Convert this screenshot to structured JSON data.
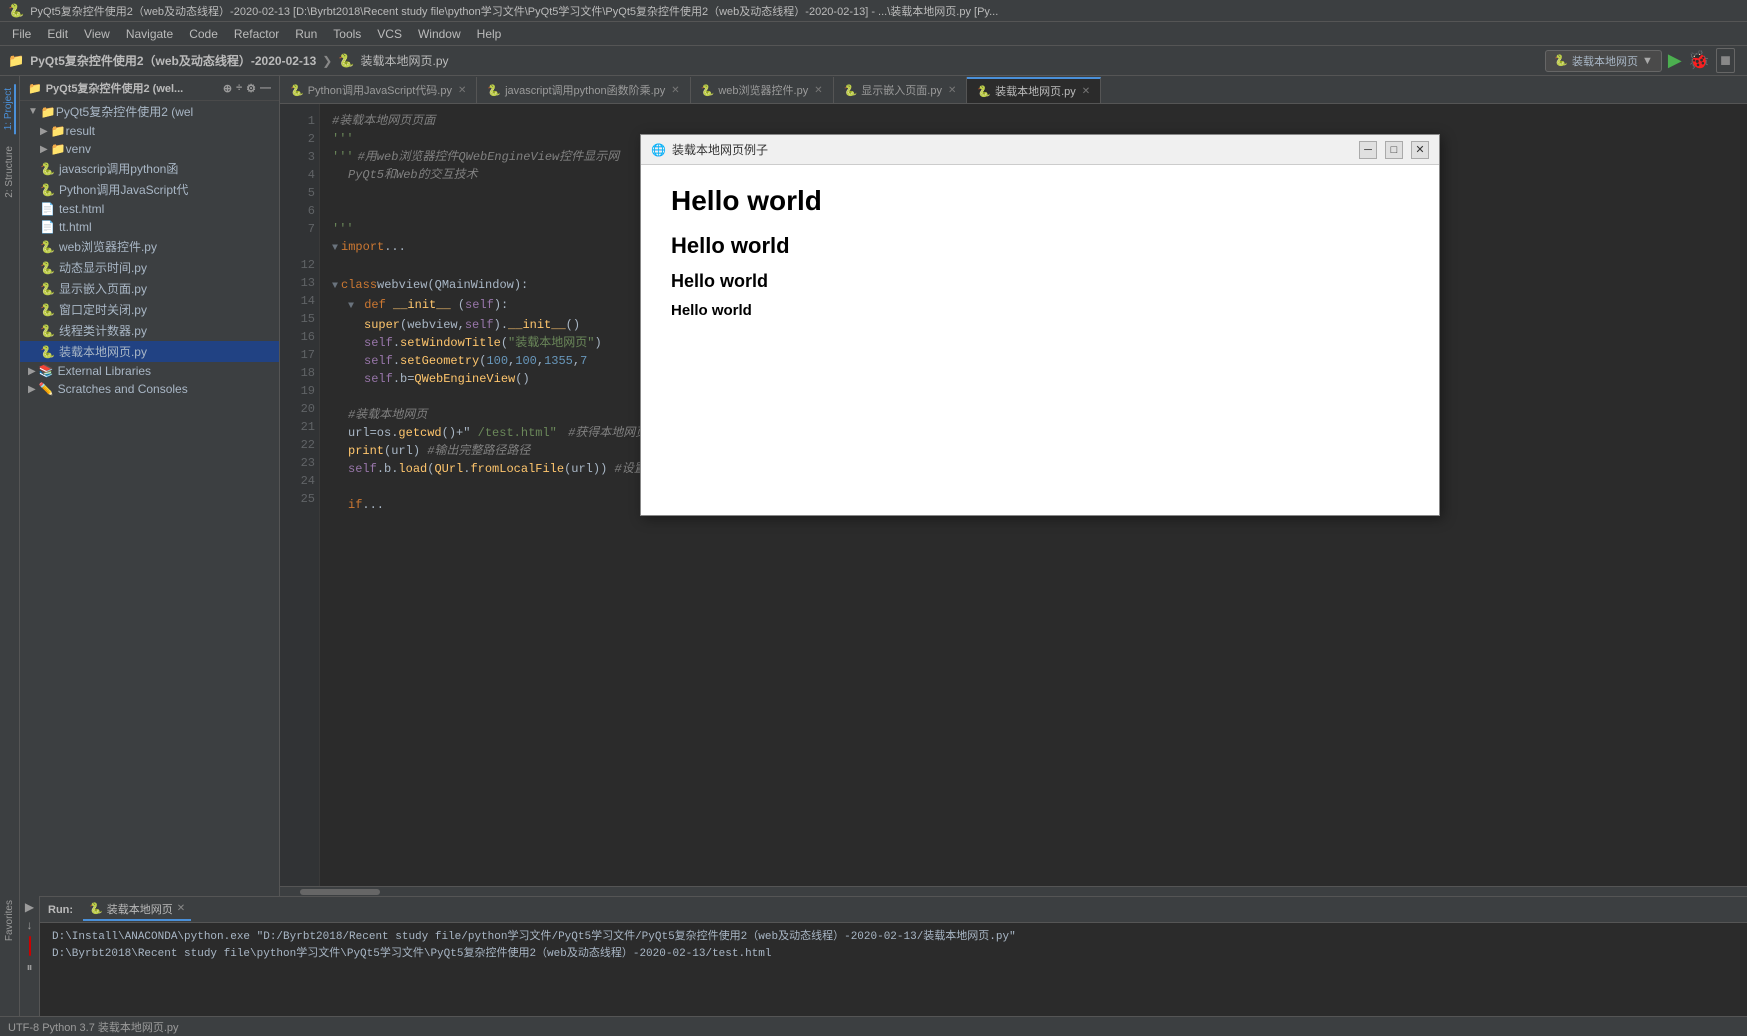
{
  "titlebar": {
    "text": "PyQt5复杂控件使用2（web及动态线程）-2020-02-13 [D:\\Byrbt2018\\Recent study file\\python学习文件\\PyQt5学习文件\\PyQt5复杂控件使用2（web及动态线程）-2020-02-13] - ...\\装载本地网页.py [Py..."
  },
  "menubar": {
    "items": [
      "File",
      "Edit",
      "View",
      "Navigate",
      "Code",
      "Refactor",
      "Run",
      "Tools",
      "VCS",
      "Window",
      "Help"
    ]
  },
  "project_toolbar": {
    "label": "PyQt5复杂控件使用2 (web...",
    "buttons": [
      "⊕",
      "÷",
      "⚙",
      "—"
    ]
  },
  "tabs": [
    {
      "label": "Python调用JavaScript代码.py",
      "active": false,
      "has_close": true
    },
    {
      "label": "javascript调用python函数阶乘.py",
      "active": false,
      "has_close": true
    },
    {
      "label": "web浏览器控件.py",
      "active": false,
      "has_close": true
    },
    {
      "label": "显示嵌入页面.py",
      "active": false,
      "has_close": true
    },
    {
      "label": "装载本地网页.py",
      "active": true,
      "has_close": true
    }
  ],
  "run_toolbar": {
    "run_label": "装载本地网页",
    "run_icon": "▶",
    "debug_icon": "🐞",
    "stop_icon": "■"
  },
  "sidebar": {
    "project_label": "Project",
    "root": "PyQt5复杂控件使用2 (wel...",
    "items": [
      {
        "label": "result",
        "type": "folder",
        "level": 1,
        "expanded": false
      },
      {
        "label": "venv",
        "type": "folder",
        "level": 1,
        "expanded": false
      },
      {
        "label": "javascrip调用python函",
        "type": "py",
        "level": 1
      },
      {
        "label": "Python调用JavaScript代",
        "type": "py",
        "level": 1
      },
      {
        "label": "test.html",
        "type": "html",
        "level": 1
      },
      {
        "label": "tt.html",
        "type": "html",
        "level": 1
      },
      {
        "label": "web浏览器控件.py",
        "type": "py",
        "level": 1
      },
      {
        "label": "动态显示时间.py",
        "type": "py",
        "level": 1
      },
      {
        "label": "显示嵌入页面.py",
        "type": "py",
        "level": 1
      },
      {
        "label": "窗口定时关闭.py",
        "type": "py",
        "level": 1
      },
      {
        "label": "线程类计数器.py",
        "type": "py",
        "level": 1
      },
      {
        "label": "装载本地网页.py",
        "type": "py",
        "level": 1,
        "selected": true
      }
    ],
    "external_libraries": "External Libraries",
    "scratches": "Scratches and Consoles"
  },
  "code": {
    "lines": [
      {
        "num": 1,
        "text": "#装载本地网页页面",
        "type": "comment"
      },
      {
        "num": 2,
        "text": "'''",
        "type": "string"
      },
      {
        "num": 3,
        "text": "'''",
        "type": "string"
      },
      {
        "num": 3,
        "text": "   #用web浏览器控件QWebEngineView控件显示网页  PyQt5和Web的交互技术",
        "type": "comment"
      },
      {
        "num": 4,
        "text": "",
        "type": "normal"
      },
      {
        "num": 5,
        "text": "",
        "type": "normal"
      },
      {
        "num": 6,
        "text": "'''",
        "type": "string"
      },
      {
        "num": 7,
        "text": "import ...",
        "type": "keyword"
      },
      {
        "num": 8,
        "text": "",
        "type": "normal"
      },
      {
        "num": 12,
        "text": "",
        "type": "normal"
      },
      {
        "num": 13,
        "text": "class webview(QMainWindow):",
        "type": "class"
      },
      {
        "num": 14,
        "text": "    def __init__(self):",
        "type": "func"
      },
      {
        "num": 15,
        "text": "        super(webview,self).__init__()",
        "type": "normal"
      },
      {
        "num": 16,
        "text": "        self.setWindowTitle(\"装载本地网页\")",
        "type": "normal"
      },
      {
        "num": 17,
        "text": "        self.setGeometry(100,100,1355,7",
        "type": "normal"
      },
      {
        "num": 18,
        "text": "        self.b=QWebEngineView()",
        "type": "normal"
      },
      {
        "num": 19,
        "text": "",
        "type": "normal"
      },
      {
        "num": 20,
        "text": "    #装载本地网页",
        "type": "comment"
      },
      {
        "num": 21,
        "text": "    url=os.getcwd()+\"/test.html\"    #获得本地网页的完整路径",
        "type": "mixed"
      },
      {
        "num": 22,
        "text": "    print(url)   #输出完整路径路径",
        "type": "mixed"
      },
      {
        "num": 23,
        "text": "    self.b.load(QUrl.fromLocalFile(url))   #设置浏览的网页",
        "type": "mixed"
      },
      {
        "num": 24,
        "text": "",
        "type": "normal"
      },
      {
        "num": 25,
        "text": "    if...",
        "type": "normal"
      }
    ]
  },
  "dialog": {
    "title": "装载本地网页例子",
    "icon": "🌐",
    "content": [
      {
        "text": "Hello world",
        "level": "h1"
      },
      {
        "text": "Hello world",
        "level": "h2"
      },
      {
        "text": "Hello world",
        "level": "h3"
      },
      {
        "text": "Hello world",
        "level": "h4"
      }
    ],
    "buttons": {
      "minimize": "─",
      "maximize": "□",
      "close": "✕"
    }
  },
  "run_panel": {
    "label": "Run:",
    "tab_label": "装载本地网页",
    "output_lines": [
      "D:\\Install\\ANACONDA\\python.exe \"D:/Byrbt2018/Recent study file/python学习文件/PyQt5学习文件/PyQt5复杂控件使用2（web及动态线程）-2020-02-13/装载本地网页.py\"",
      "D:\\Byrbt2018\\Recent study file\\python学习文件\\PyQt5学习文件\\PyQt5复杂控件使用2（web及动态线程）-2020-02-13/test.html"
    ]
  },
  "colors": {
    "accent": "#4a90d9",
    "bg_dark": "#2b2b2b",
    "bg_panel": "#3c3f41",
    "text_main": "#a9b7c6",
    "selected": "#214283"
  }
}
